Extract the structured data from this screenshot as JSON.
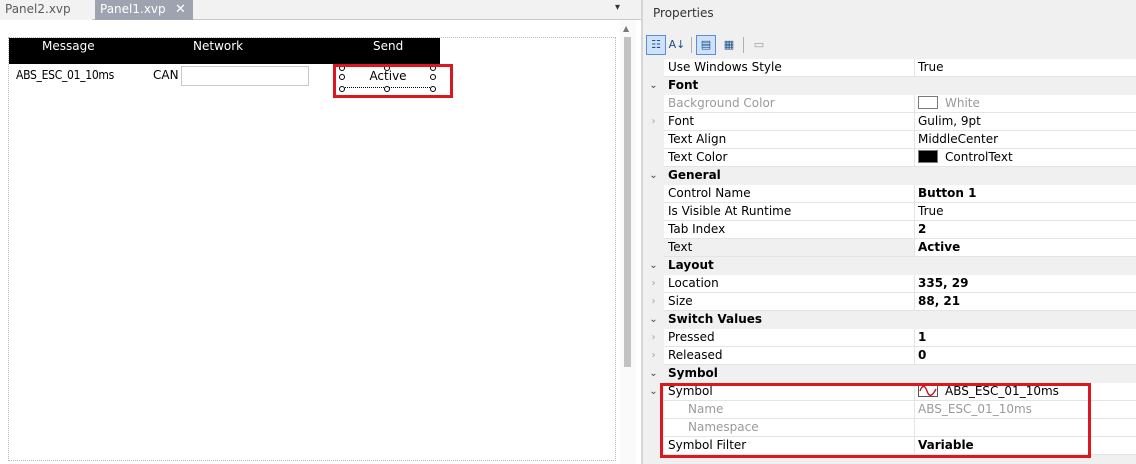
{
  "tabs": [
    {
      "label": "Panel2.xvp"
    },
    {
      "label": "Panel1.xvp",
      "close": "✕"
    }
  ],
  "tab_menu_icon": "▾",
  "canvas": {
    "headers": {
      "message": "Message",
      "network": "Network",
      "send": "Send"
    },
    "row": {
      "message": "ABS_ESC_01_10ms",
      "network": "CAN",
      "button_text": "Active"
    }
  },
  "properties": {
    "title": "Properties",
    "toolbar_icons": [
      "categorized-icon",
      "alphabetical-icon",
      "properties-icon",
      "events-icon",
      "property-pages-icon"
    ],
    "rows": [
      {
        "type": "prop",
        "name": "Use Windows Style",
        "value": "True"
      },
      {
        "type": "cat",
        "name": "Font"
      },
      {
        "type": "prop",
        "name": "Background Color",
        "value": "White",
        "swatch": "#ffffff",
        "disabled": true
      },
      {
        "type": "prop",
        "name": "Font",
        "value": "Gulim, 9pt",
        "expandable": true
      },
      {
        "type": "prop",
        "name": "Text Align",
        "value": "MiddleCenter"
      },
      {
        "type": "prop",
        "name": "Text Color",
        "value": "ControlText",
        "swatch": "#000000"
      },
      {
        "type": "cat",
        "name": "General"
      },
      {
        "type": "prop",
        "name": "Control Name",
        "value": "Button 1",
        "bold": true
      },
      {
        "type": "prop",
        "name": "Is Visible At Runtime",
        "value": "True"
      },
      {
        "type": "prop",
        "name": "Tab Index",
        "value": "2",
        "bold": true
      },
      {
        "type": "prop",
        "name": "Text",
        "value": "Active",
        "bold": true,
        "selected": true
      },
      {
        "type": "cat",
        "name": "Layout"
      },
      {
        "type": "prop",
        "name": "Location",
        "value": "335, 29",
        "bold": true,
        "expandable": true
      },
      {
        "type": "prop",
        "name": "Size",
        "value": "88, 21",
        "bold": true,
        "expandable": true
      },
      {
        "type": "cat",
        "name": "Switch Values"
      },
      {
        "type": "prop",
        "name": "Pressed",
        "value": "1",
        "bold": true,
        "expandable": true
      },
      {
        "type": "prop",
        "name": "Released",
        "value": "0",
        "bold": true,
        "expandable": true
      },
      {
        "type": "cat",
        "name": "Symbol"
      },
      {
        "type": "prop",
        "name": "Symbol",
        "value": "ABS_ESC_01_10ms",
        "symbol_icon": true,
        "expanded": true
      },
      {
        "type": "prop",
        "name": "Name",
        "value": "ABS_ESC_01_10ms",
        "disabled": true,
        "indent": true
      },
      {
        "type": "prop",
        "name": "Namespace",
        "value": "",
        "disabled": true,
        "indent": true
      },
      {
        "type": "prop",
        "name": "Symbol Filter",
        "value": "Variable",
        "bold": true
      }
    ]
  }
}
